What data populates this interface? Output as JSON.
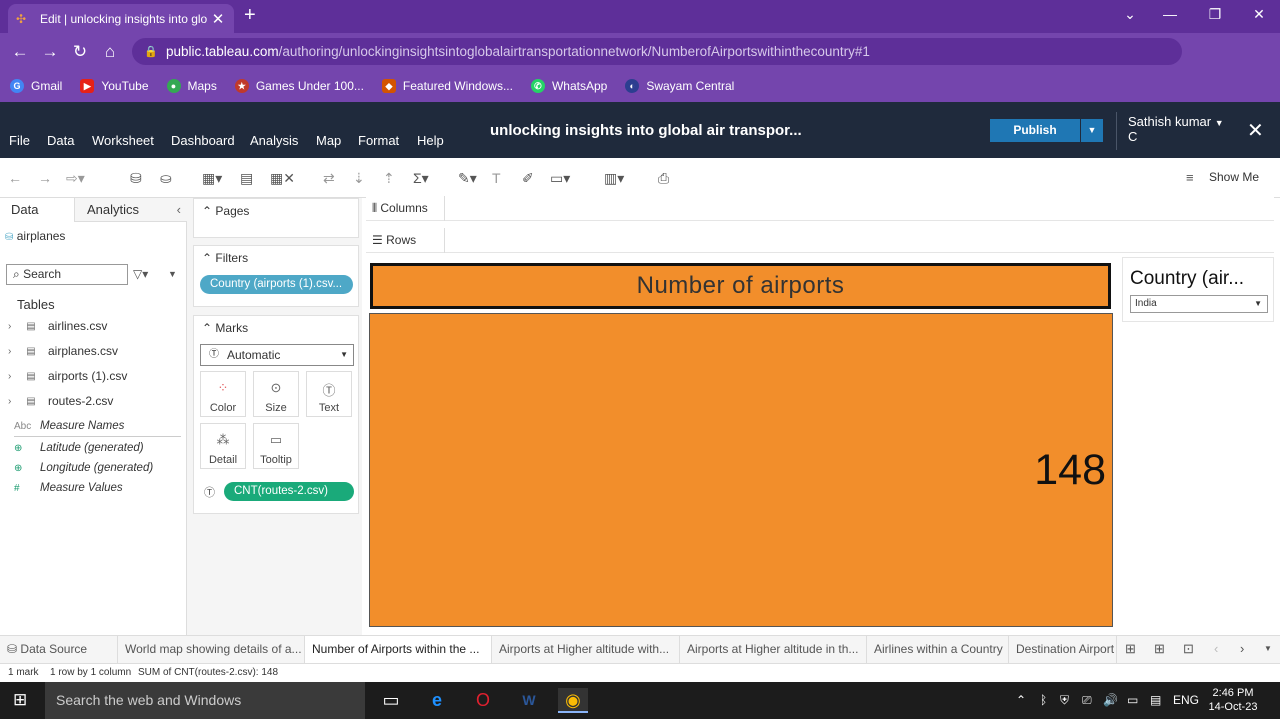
{
  "browser": {
    "tab_title": "Edit | unlocking insights into glo",
    "url_host": "public.tableau.com",
    "url_path": "/authoring/unlockinginsightsintoglobalairtransportationnetwork/NumberofAirportswithinthecountry#1",
    "avatar_letter": "C",
    "bookmarks": [
      "Gmail",
      "YouTube",
      "Maps",
      "Games Under 100...",
      "Featured Windows...",
      "WhatsApp",
      "Swayam Central"
    ]
  },
  "header": {
    "menu": [
      "File",
      "Data",
      "Worksheet",
      "Dashboard",
      "Analysis",
      "Map",
      "Format",
      "Help"
    ],
    "workbook_title": "unlocking insights into global air transpor...",
    "publish_label": "Publish",
    "user_line1": "Sathish kumar",
    "user_line2": "C",
    "show_me": "Show Me"
  },
  "data_pane": {
    "tab_data": "Data",
    "tab_analytics": "Analytics",
    "datasource": "airplanes",
    "search_placeholder": "Search",
    "tables_heading": "Tables",
    "tables": [
      "airlines.csv",
      "airplanes.csv",
      "airports (1).csv",
      "routes-2.csv"
    ],
    "measure_fields": [
      {
        "icon": "Abc",
        "name": "Measure Names"
      },
      {
        "icon": "⊕",
        "name": "Latitude (generated)"
      },
      {
        "icon": "⊕",
        "name": "Longitude (generated)"
      },
      {
        "icon": "#",
        "name": "Measure Values"
      }
    ]
  },
  "cards": {
    "pages": "Pages",
    "filters": "Filters",
    "filter_pill": "Country (airports (1).csv...",
    "marks": "Marks",
    "mark_type": "Automatic",
    "mark_buttons": [
      "Color",
      "Size",
      "Text",
      "Detail",
      "Tooltip"
    ],
    "text_pill": "CNT(routes-2.csv)"
  },
  "shelves": {
    "columns": "Columns",
    "rows": "Rows"
  },
  "view": {
    "title": "Number of airports",
    "value": "148",
    "accent": "#f28e2b"
  },
  "quick_filter": {
    "title": "Country (air...",
    "selected": "India"
  },
  "sheet_tabs": [
    "Data Source",
    "World map showing details of a...",
    "Number of Airports within the ...",
    "Airports at Higher altitude with...",
    "Airports at Higher altitude in th...",
    "Airlines within a Country",
    "Destination Airport"
  ],
  "status": {
    "marks": "1 mark",
    "size": "1 row by 1 column",
    "sum": "SUM of CNT(routes-2.csv): 148"
  },
  "taskbar": {
    "search": "Search the web and Windows",
    "lang": "ENG",
    "time": "2:46 PM",
    "date": "14-Oct-23"
  }
}
